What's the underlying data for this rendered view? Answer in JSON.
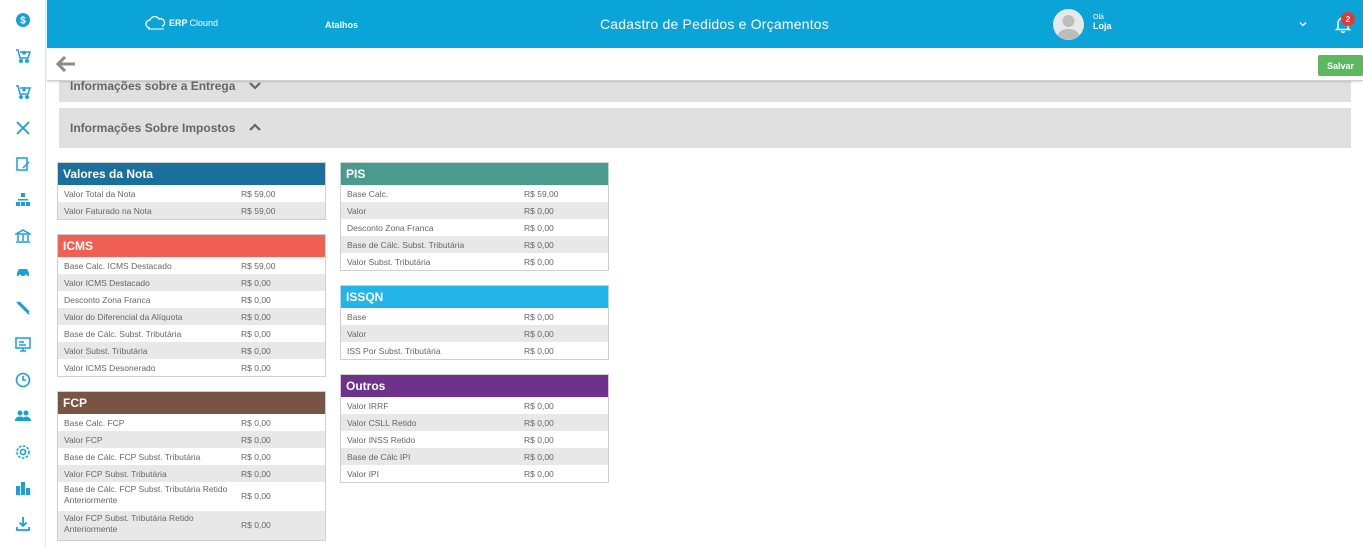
{
  "header": {
    "logo_brand": "ERP",
    "logo_rest": "Clound",
    "atalhos": "Atalhos",
    "title": "Cadastro de Pedidos e Orçamentos",
    "greeting": "Olá",
    "user": "Loja",
    "notifications": "2"
  },
  "toolbar": {
    "save": "Salvar"
  },
  "sections": {
    "entrega": "Informações sobre a Entrega",
    "impostos": "Informações Sobre Impostos"
  },
  "panels": {
    "valores": {
      "title": "Valores da Nota",
      "color": "#1a6f9c",
      "rows": [
        {
          "label": "Valor Total da Nota",
          "value": "R$ 59,00"
        },
        {
          "label": "Valor Faturado na Nota",
          "value": "R$ 59,00"
        }
      ]
    },
    "icms": {
      "title": "ICMS",
      "color": "#f06154",
      "rows": [
        {
          "label": "Base Calc. ICMS Destacado",
          "value": "R$ 59,00"
        },
        {
          "label": "Valor ICMS Destacado",
          "value": "R$ 0,00"
        },
        {
          "label": "Desconto Zona Franca",
          "value": "R$ 0,00"
        },
        {
          "label": "Valor do Diferencial da Alíquota",
          "value": "R$ 0,00"
        },
        {
          "label": "Base de Cálc. Subst. Tributária",
          "value": "R$ 0,00"
        },
        {
          "label": "Valor Subst. Tributária",
          "value": "R$ 0,00"
        },
        {
          "label": "Valor ICMS Desonerado",
          "value": "R$ 0,00"
        }
      ]
    },
    "fcp": {
      "title": "FCP",
      "color": "#7a5443",
      "rows": [
        {
          "label": "Base Calc. FCP",
          "value": "R$ 0,00"
        },
        {
          "label": "Valor FCP",
          "value": "R$ 0,00"
        },
        {
          "label": "Base de Cálc. FCP Subst. Tributária",
          "value": "R$ 0,00"
        },
        {
          "label": "Valor FCP Subst. Tributária",
          "value": "R$ 0,00"
        },
        {
          "label": "Base de Cálc. FCP Subst. Tributária Retido Anteriormente",
          "value": "R$ 0,00"
        },
        {
          "label": "Valor FCP Subst. Tributária Retido Anteriormente",
          "value": "R$ 0,00"
        }
      ]
    },
    "pis": {
      "title": "PIS",
      "color": "#4a9b8e",
      "rows": [
        {
          "label": "Base Calc.",
          "value": "R$ 59,00"
        },
        {
          "label": "Valor",
          "value": "R$ 0,00"
        },
        {
          "label": "Desconto Zona Franca",
          "value": "R$ 0,00"
        },
        {
          "label": "Base de Cálc. Subst. Tributária",
          "value": "R$ 0,00"
        },
        {
          "label": "Valor Subst. Tributária",
          "value": "R$ 0,00"
        }
      ]
    },
    "issqn": {
      "title": "ISSQN",
      "color": "#23b5e8",
      "rows": [
        {
          "label": "Base",
          "value": "R$ 0,00"
        },
        {
          "label": "Valor",
          "value": "R$ 0,00"
        },
        {
          "label": "ISS Por Subst. Tributária",
          "value": "R$ 0,00"
        }
      ]
    },
    "outros": {
      "title": "Outros",
      "color": "#6d338b",
      "rows": [
        {
          "label": "Valor IRRF",
          "value": "R$ 0,00"
        },
        {
          "label": "Valor CSLL Retido",
          "value": "R$ 0,00"
        },
        {
          "label": "Valor INSS Retido",
          "value": "R$ 0,00"
        },
        {
          "label": "Base de Cálc IPI",
          "value": "R$ 0,00"
        },
        {
          "label": "Valor IPI",
          "value": "R$ 0,00"
        }
      ]
    }
  },
  "colors": {
    "header": "#0ba4d8",
    "sidebar_icon": "#1a9fd6",
    "save": "#5cb85c"
  },
  "sidebar_icons": [
    "dollar-icon",
    "cart-plus-icon",
    "cart-down-icon",
    "tools-icon",
    "edit-note-icon",
    "sitemap-icon",
    "bank-icon",
    "car-icon",
    "pen-icon",
    "monitor-icon",
    "clock-icon",
    "users-icon",
    "settings-icon",
    "chart-icon",
    "download-icon"
  ]
}
